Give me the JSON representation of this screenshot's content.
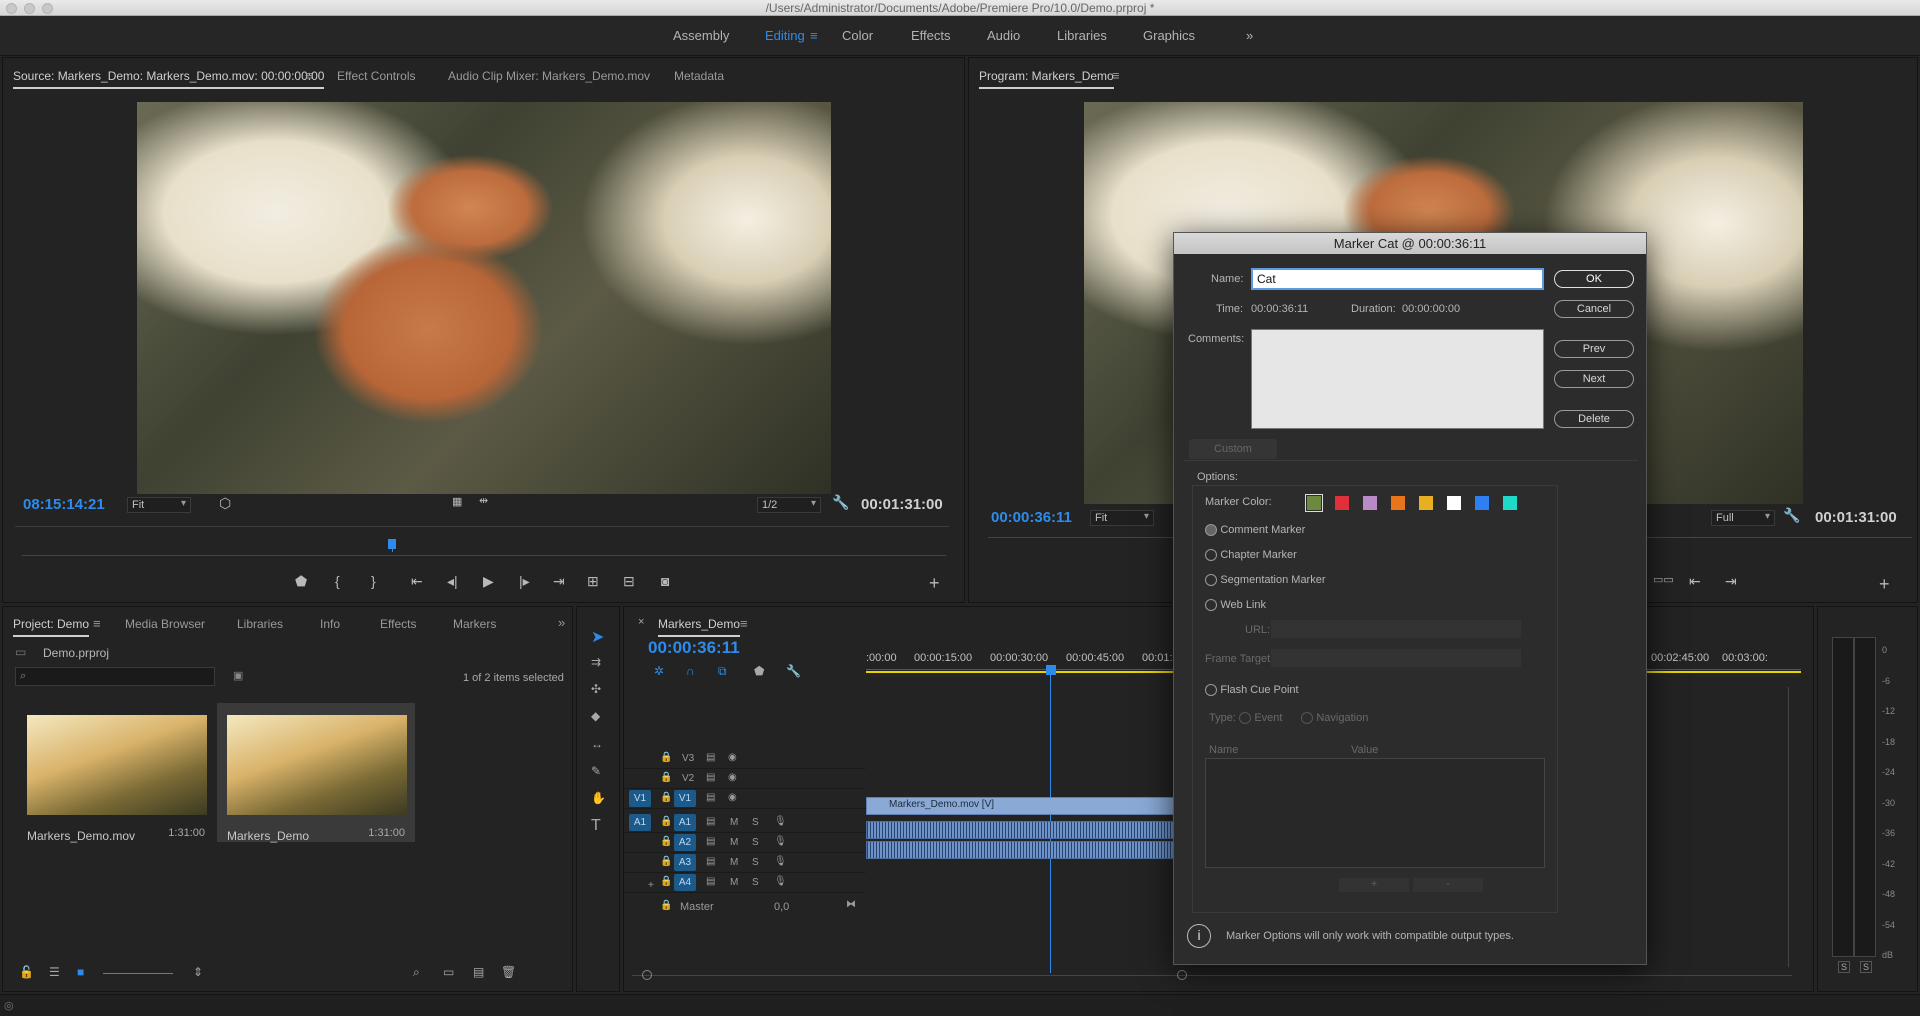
{
  "window_title": "/Users/Administrator/Documents/Adobe/Premiere Pro/10.0/Demo.prproj *",
  "workspaces": [
    "Assembly",
    "Editing",
    "Color",
    "Effects",
    "Audio",
    "Libraries",
    "Graphics"
  ],
  "workspaces_more": "»",
  "source_monitor": {
    "tabs": [
      "Source: Markers_Demo: Markers_Demo.mov: 00:00:00:00",
      "Effect Controls",
      "Audio Clip Mixer: Markers_Demo.mov",
      "Metadata"
    ],
    "timecode_in": "08:15:14:21",
    "fit": "Fit",
    "resolution": "1/2",
    "timecode_duration": "00:01:31:00"
  },
  "program_monitor": {
    "title": "Program: Markers_Demo",
    "timecode_in": "00:00:36:11",
    "fit": "Fit",
    "resolution": "Full",
    "timecode_duration": "00:01:31:00"
  },
  "project_panel": {
    "tabs": [
      "Project: Demo",
      "Media Browser",
      "Libraries",
      "Info",
      "Effects",
      "Markers"
    ],
    "file": "Demo.prproj",
    "selection": "1 of 2 items selected",
    "items": [
      {
        "name": "Markers_Demo.mov",
        "duration": "1:31:00"
      },
      {
        "name": "Markers_Demo",
        "duration": "1:31:00"
      }
    ]
  },
  "timeline": {
    "title": "Markers_Demo",
    "timecode": "00:00:36:11",
    "ruler": [
      ":00:00",
      "00:00:15:00",
      "00:00:30:00",
      "00:00:45:00",
      "00:01:0"
    ],
    "ruler_right": [
      "00:02:45:00",
      "00:03:00:"
    ],
    "video_tracks": [
      "V3",
      "V2",
      "V1"
    ],
    "audio_tracks": [
      "A1",
      "A2",
      "A3",
      "A4"
    ],
    "source_v": "V1",
    "source_a": "A1",
    "mute": "M",
    "solo": "S",
    "clip_name": "Markers_Demo.mov [V]",
    "master": "Master",
    "master_value": "0,0"
  },
  "meter_scale": [
    "0",
    "-6",
    "-12",
    "-18",
    "-24",
    "-30",
    "-36",
    "-42",
    "-48",
    "-54",
    "dB"
  ],
  "meter_buttons": [
    "S",
    "S"
  ],
  "dialog": {
    "title": "Marker Cat @ 00:00:36:11",
    "name_label": "Name:",
    "name_value": "Cat",
    "time_label": "Time:",
    "time_value": "00:00:36:11",
    "duration_label": "Duration:",
    "duration_value": "00:00:00:00",
    "comments_label": "Comments:",
    "buttons": {
      "ok": "OK",
      "cancel": "Cancel",
      "prev": "Prev",
      "next": "Next",
      "delete": "Delete"
    },
    "custom": "Custom",
    "options": "Options:",
    "marker_color": "Marker Color:",
    "colors": [
      "#6b8a3e",
      "#e0303a",
      "#b88ac8",
      "#e8741c",
      "#e8b020",
      "#ffffff",
      "#2d7ff2",
      "#20d8c8"
    ],
    "types": [
      "Comment Marker",
      "Chapter Marker",
      "Segmentation Marker",
      "Web Link"
    ],
    "url": "URL:",
    "frame_target": "Frame Target:",
    "flash": "Flash Cue Point",
    "type_label": "Type:",
    "event": "Event",
    "navigation": "Navigation",
    "col_name": "Name",
    "col_value": "Value",
    "plus": "+",
    "minus": "-",
    "info": "Marker Options will only work with compatible output types."
  }
}
